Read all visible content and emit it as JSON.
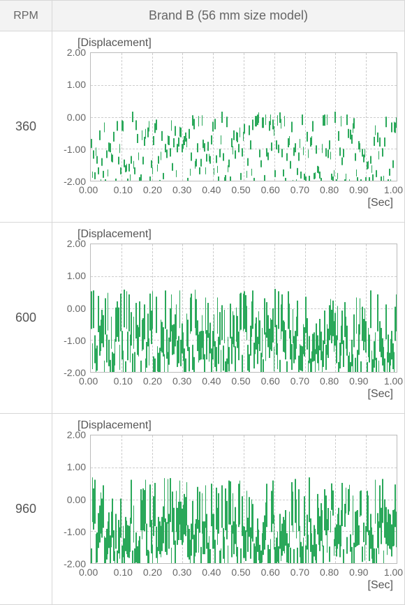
{
  "header": {
    "rpm_label": "RPM",
    "title": "Brand B (56 mm size model)"
  },
  "rows": [
    {
      "rpm": "360",
      "title": "[Displacement]",
      "xunit": "[Sec]",
      "amp": 0.17
    },
    {
      "rpm": "600",
      "title": "[Displacement]",
      "xunit": "[Sec]",
      "amp": 0.6
    },
    {
      "rpm": "960",
      "title": "[Displacement]",
      "xunit": "[Sec]",
      "amp": 0.7
    }
  ],
  "yticks": [
    "2.00",
    "1.00",
    "0.00",
    "-1.00",
    "-2.00"
  ],
  "xticks": [
    "0.00",
    "0.10",
    "0.20",
    "0.30",
    "0.40",
    "0.50",
    "0.60",
    "0.70",
    "0.80",
    "0.90",
    "1.00"
  ],
  "chart_data": [
    {
      "type": "line",
      "title": "[Displacement]",
      "rpm": 360,
      "xlabel": "[Sec]",
      "ylabel": "",
      "xlim": [
        0.0,
        1.0
      ],
      "ylim": [
        -2.0,
        2.0
      ],
      "note": "dense noise signal centered at 0",
      "x_range": [
        0.0,
        1.0
      ],
      "approx_amplitude": 0.17
    },
    {
      "type": "line",
      "title": "[Displacement]",
      "rpm": 600,
      "xlabel": "[Sec]",
      "ylabel": "",
      "xlim": [
        0.0,
        1.0
      ],
      "ylim": [
        -2.0,
        2.0
      ],
      "note": "dense noise signal centered at 0",
      "x_range": [
        0.0,
        1.0
      ],
      "approx_amplitude": 0.6
    },
    {
      "type": "line",
      "title": "[Displacement]",
      "rpm": 960,
      "xlabel": "[Sec]",
      "ylabel": "",
      "xlim": [
        0.0,
        1.0
      ],
      "ylim": [
        -2.0,
        2.0
      ],
      "note": "dense noise signal centered at 0, slight dips near 0.8-0.9s",
      "x_range": [
        0.0,
        1.0
      ],
      "approx_amplitude": 0.7
    }
  ]
}
